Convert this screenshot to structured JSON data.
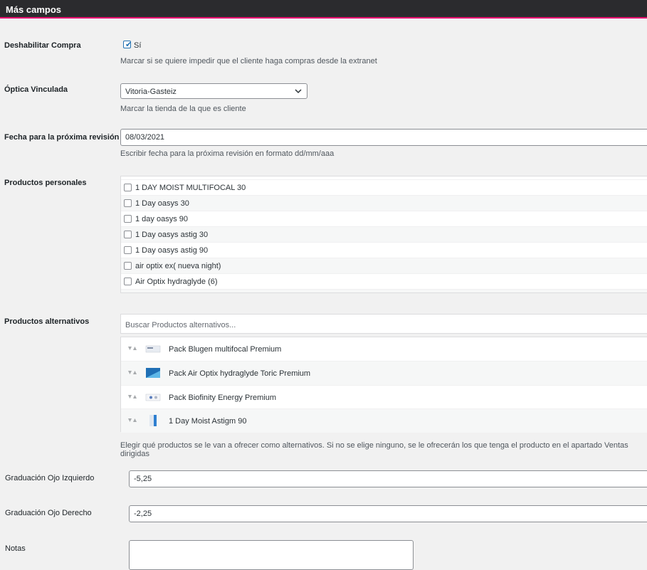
{
  "header": {
    "title": "Más campos"
  },
  "disable_purchase": {
    "label": "Deshabilitar Compra",
    "checkbox_label": "Sí",
    "checked": true,
    "description": "Marcar si se quiere impedir que el cliente haga compras desde la extranet"
  },
  "linked_optics": {
    "label": "Óptica Vinculada",
    "selected": "Vitoria-Gasteiz",
    "description": "Marcar la tienda de la que es cliente"
  },
  "next_review": {
    "label": "Fecha para la próxima revisión",
    "value": "08/03/2021",
    "description": "Escribir fecha para la próxima revisión en formato dd/mm/aaa"
  },
  "personal_products": {
    "label": "Productos personales",
    "items": [
      "1 DAY MOIST MULTIFOCAL 30",
      "1 Day oasys 30",
      "1 day oasys 90",
      "1 Day oasys astig 30",
      "1 Day oasys astig 90",
      "air optix ex( nueva night)",
      "Air Optix hydraglyde (6)"
    ]
  },
  "alternative_products": {
    "label": "Productos alternativos",
    "search_placeholder": "Buscar Productos alternativos...",
    "items": [
      "Pack Blugen multifocal Premium",
      "Pack Air Optix hydraglyde Toric Premium",
      "Pack Biofinity Energy Premium",
      "1 Day Moist Astigm 90"
    ],
    "description": "Elegir qué productos se le van a ofrecer como alternativos. Si no se elige ninguno, se le ofrecerán los que tenga el producto en el apartado Ventas dirigidas"
  },
  "left_eye": {
    "label": "Graduación Ojo Izquierdo",
    "value": "-5,25"
  },
  "right_eye": {
    "label": "Graduación Ojo Derecho",
    "value": "-2,25"
  },
  "notes": {
    "label": "Notas",
    "value": ""
  },
  "colors": {
    "accent": "#e6006e",
    "header_bg": "#2b2b2e",
    "check_blue": "#2271b1"
  }
}
